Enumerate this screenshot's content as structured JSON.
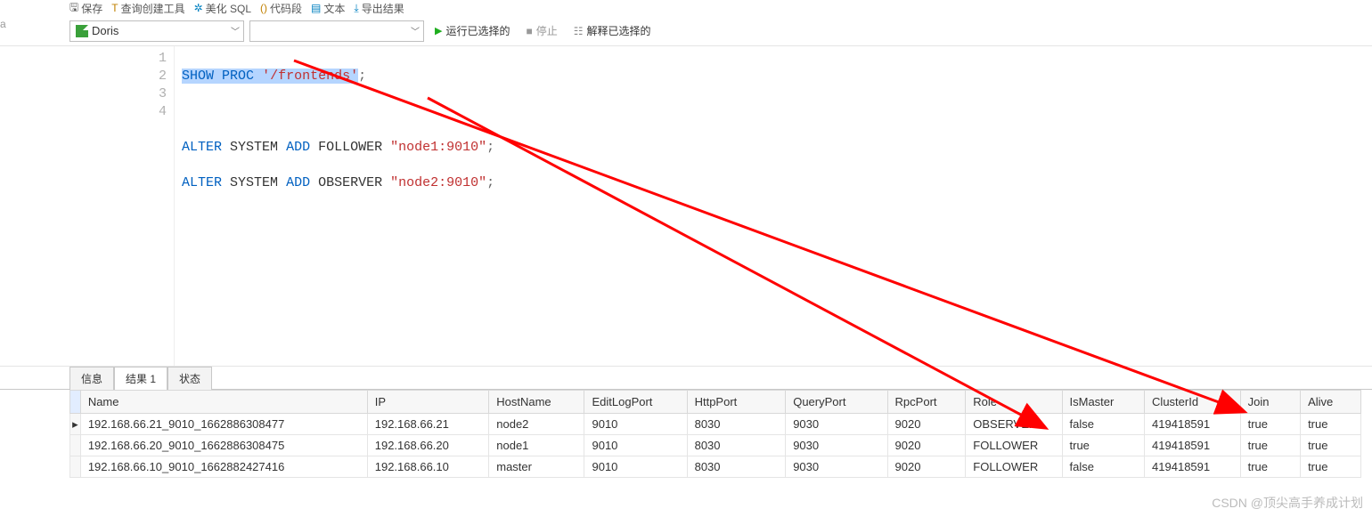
{
  "toolbar_top": {
    "save": "保存",
    "query_builder": "查询创建工具",
    "beautify_sql": "美化 SQL",
    "snippet": "代码段",
    "text": "文本",
    "export": "导出结果"
  },
  "toolbar_sel": {
    "database": "Doris",
    "schema": "",
    "run": "运行已选择的",
    "stop": "停止",
    "explain": "解释已选择的"
  },
  "gutter": [
    "1",
    "2",
    "3",
    "4"
  ],
  "code": {
    "l1": {
      "kw": "SHOW",
      "kw2": "PROC",
      "str": "'/frontends'",
      "end": ";"
    },
    "l3": {
      "kw": "ALTER",
      "t1": "SYSTEM",
      "kw2": "ADD",
      "t2": "FOLLOWER",
      "str": "\"node1:9010\"",
      "end": ";"
    },
    "l4": {
      "kw": "ALTER",
      "t1": "SYSTEM",
      "kw2": "ADD",
      "t2": "OBSERVER",
      "str": "\"node2:9010\"",
      "end": ";"
    }
  },
  "tabs": {
    "info": "信息",
    "result1": "结果 1",
    "status": "状态"
  },
  "columns": [
    "Name",
    "IP",
    "HostName",
    "EditLogPort",
    "HttpPort",
    "QueryPort",
    "RpcPort",
    "Role",
    "IsMaster",
    "ClusterId",
    "Join",
    "Alive"
  ],
  "rows": [
    {
      "Name": "192.168.66.21_9010_1662886308477",
      "IP": "192.168.66.21",
      "HostName": "node2",
      "EditLogPort": "9010",
      "HttpPort": "8030",
      "QueryPort": "9030",
      "RpcPort": "9020",
      "Role": "OBSERVER",
      "IsMaster": "false",
      "ClusterId": "419418591",
      "Join": "true",
      "Alive": "true"
    },
    {
      "Name": "192.168.66.20_9010_1662886308475",
      "IP": "192.168.66.20",
      "HostName": "node1",
      "EditLogPort": "9010",
      "HttpPort": "8030",
      "QueryPort": "9030",
      "RpcPort": "9020",
      "Role": "FOLLOWER",
      "IsMaster": "true",
      "ClusterId": "419418591",
      "Join": "true",
      "Alive": "true"
    },
    {
      "Name": "192.168.66.10_9010_1662882427416",
      "IP": "192.168.66.10",
      "HostName": "master",
      "EditLogPort": "9010",
      "HttpPort": "8030",
      "QueryPort": "9030",
      "RpcPort": "9020",
      "Role": "FOLLOWER",
      "IsMaster": "false",
      "ClusterId": "419418591",
      "Join": "true",
      "Alive": "true"
    }
  ],
  "watermark": "CSDN @顶尖高手养成计划",
  "left_trunc": "a",
  "arrow_indicator": "▸"
}
